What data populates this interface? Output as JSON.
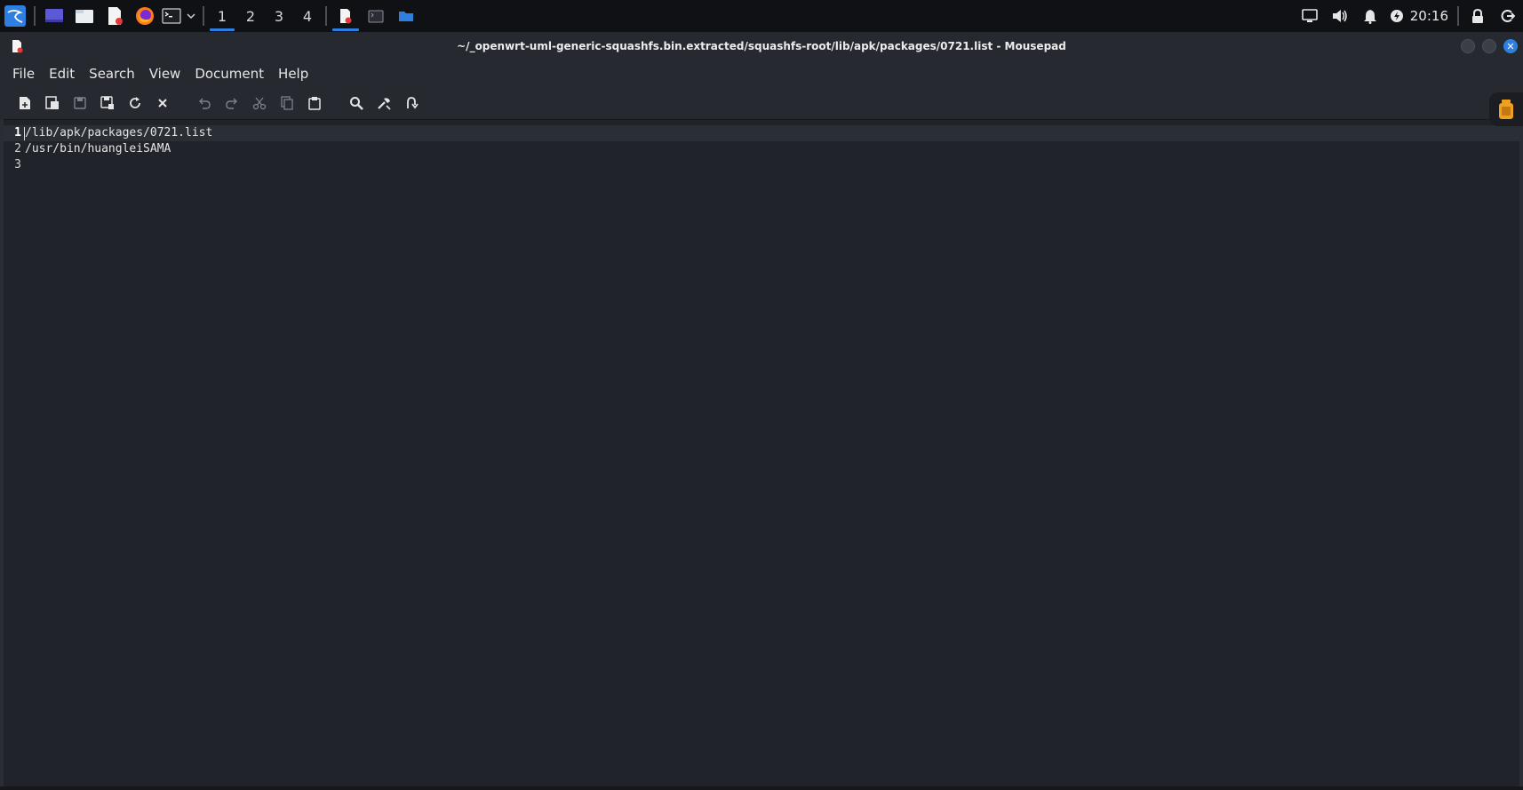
{
  "panel": {
    "workspaces": [
      "1",
      "2",
      "3",
      "4"
    ],
    "active_workspace": "1",
    "clock": "20:16",
    "accent": "#2f7fe0"
  },
  "window": {
    "title": "~/_openwrt-uml-generic-squashfs.bin.extracted/squashfs-root/lib/apk/packages/0721.list - Mousepad"
  },
  "menu": [
    "File",
    "Edit",
    "Search",
    "View",
    "Document",
    "Help"
  ],
  "toolbar_icons": [
    "new-document-icon",
    "new-window-icon",
    "save-icon",
    "save-as-icon",
    "reload-icon",
    "close-tab-icon",
    "undo-icon",
    "redo-icon",
    "cut-icon",
    "copy-icon",
    "paste-icon",
    "find-icon",
    "find-replace-icon",
    "go-to-line-icon"
  ],
  "editor": {
    "lines": [
      {
        "number": "1",
        "text": "/lib/apk/packages/0721.list"
      },
      {
        "number": "2",
        "text": "/usr/bin/huangleiSAMA"
      },
      {
        "number": "3",
        "text": ""
      }
    ],
    "current_line": "1"
  }
}
